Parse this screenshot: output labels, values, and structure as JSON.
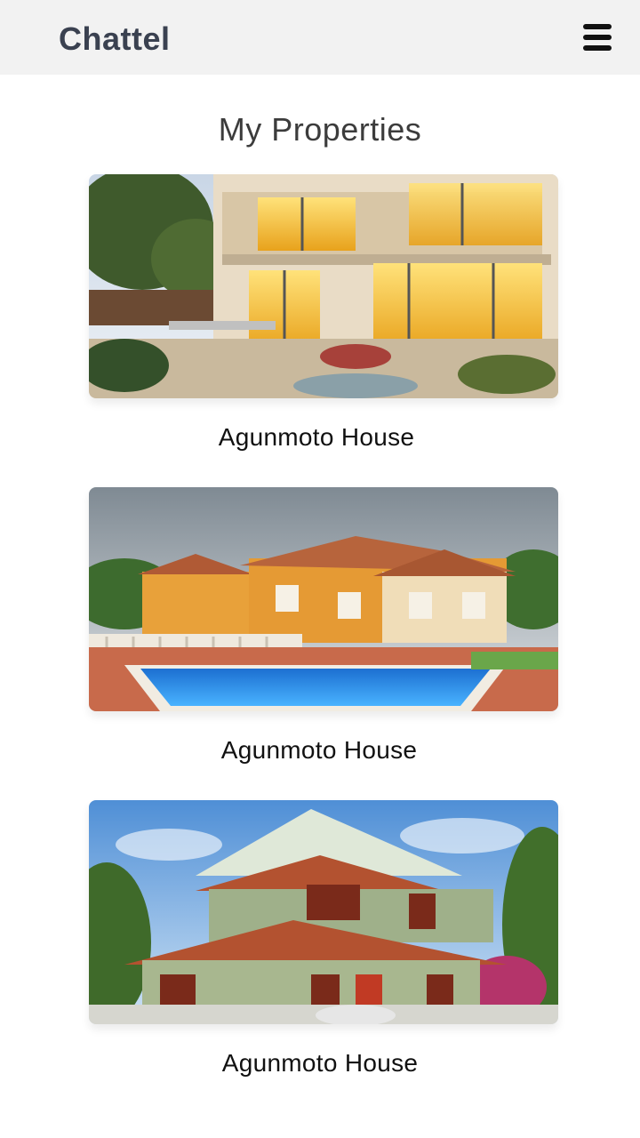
{
  "header": {
    "brand": "Chattel",
    "menu_icon": "hamburger-menu-icon"
  },
  "page": {
    "title": "My Properties"
  },
  "properties": [
    {
      "name": "Agunmoto House",
      "image": "modern-villa-patio-photo"
    },
    {
      "name": "Agunmoto House",
      "image": "villa-with-pool-photo"
    },
    {
      "name": "Agunmoto House",
      "image": "two-storey-house-photo"
    }
  ],
  "colors": {
    "header_bg": "#f2f2f2",
    "brand_text": "#3a4150",
    "title_text": "#3c3c3c"
  }
}
